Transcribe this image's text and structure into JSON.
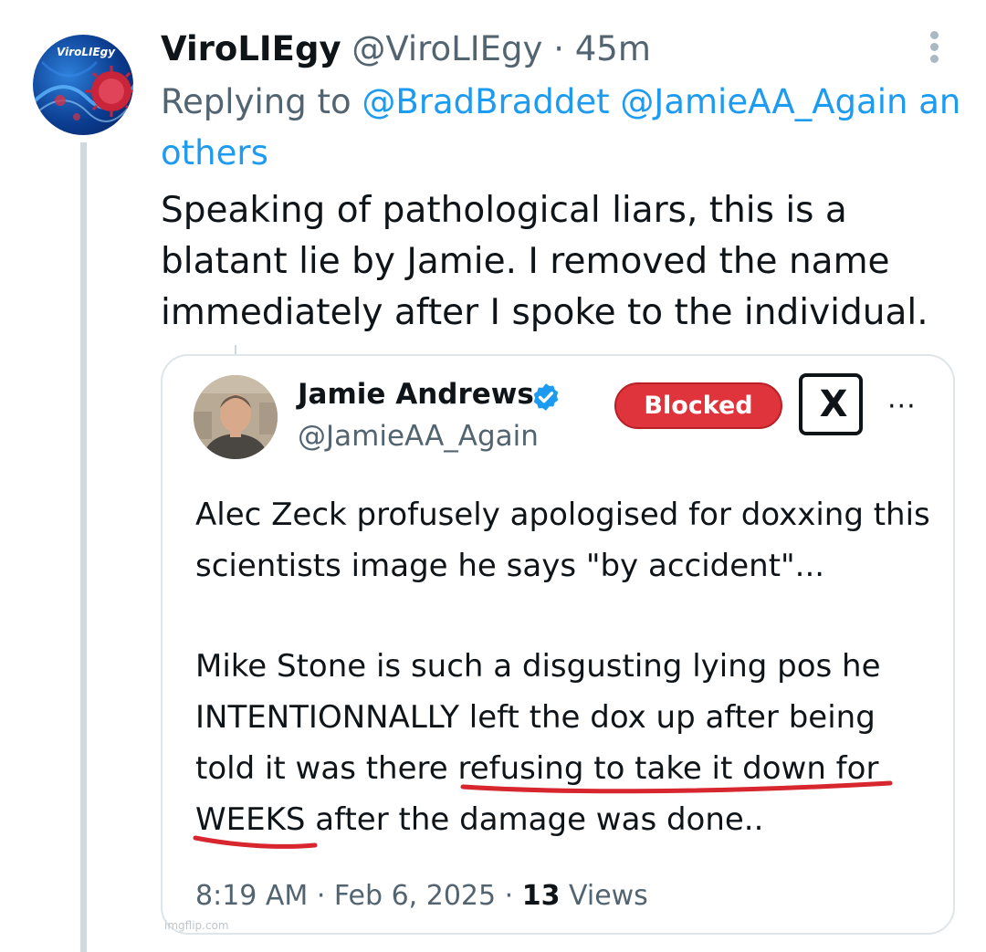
{
  "reply": {
    "avatar_label": "ViroLIEgy",
    "display_name": "ViroLIEgy",
    "handle": "@ViroLIEgy",
    "separator": " · ",
    "time": "45m",
    "replying_prefix": "Replying to ",
    "mention_1": "@BradBraddet",
    "mention_2": "@JamieAA_Again",
    "mention_rest_a": " an",
    "mention_rest_b": "others",
    "text": "Speaking of pathological liars, this is a blatant lie by Jamie. I removed the name immediately after I spoke to the individual."
  },
  "quoted": {
    "display_name": "Jamie Andrews",
    "handle": "@JamieAA_Again",
    "blocked_label": "Blocked",
    "x_logo_label": "X",
    "more_label": "···",
    "paragraph_1": "Alec Zeck profusely apologised for doxxing this scientists image he says \"by accident\"...",
    "paragraph_2": "Mike Stone is such a disgusting lying pos he INTENTIONNALLY left the dox up after being told it was there refusing to take it down for WEEKS after the damage was done..",
    "time": "8:19 AM",
    "date": "Feb 6, 2025",
    "views_count": "13",
    "views_label": " Views",
    "meta_separator": " · "
  },
  "watermark": "imgflip.com",
  "colors": {
    "link": "#1d9bf0",
    "muted": "#536471",
    "blocked": "#e0343d",
    "underline": "#d8262e",
    "thread": "#cfd9de"
  },
  "icons": {
    "more": "more-vertical-icon",
    "verified": "verified-badge-icon",
    "x_logo": "x-logo-icon"
  }
}
